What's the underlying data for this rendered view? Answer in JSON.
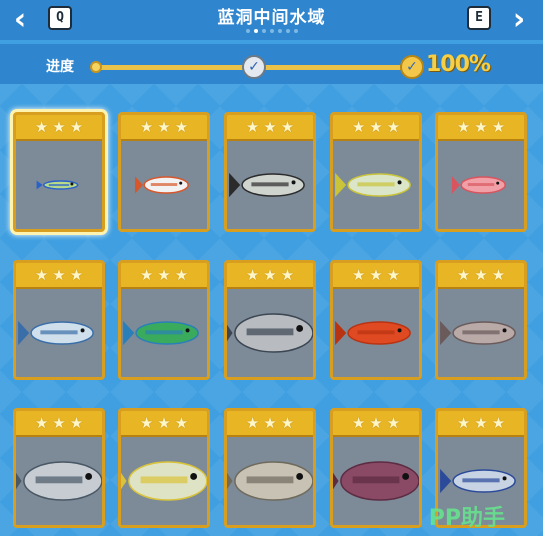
{
  "header": {
    "title": "蓝洞中间水域",
    "prev_key": "Q",
    "next_key": "E",
    "page_dots": 7,
    "active_dot": 1
  },
  "progress": {
    "label": "进度",
    "percent_text": "100%",
    "value": 1.0
  },
  "cards": [
    {
      "name": "tiny-green-fish",
      "stars": 3,
      "selected": true,
      "body": "#b8d98a",
      "accent": "#2a62c9",
      "size": "xs"
    },
    {
      "name": "clownfish",
      "stars": 3,
      "selected": false,
      "body": "#f2f2f2",
      "accent": "#d8572a",
      "size": "s"
    },
    {
      "name": "striped-fish",
      "stars": 3,
      "selected": false,
      "body": "#cfd4cf",
      "accent": "#2b2b2b",
      "size": "m"
    },
    {
      "name": "yellowtail-fish",
      "stars": 3,
      "selected": false,
      "body": "#dbe5c8",
      "accent": "#c9c43a",
      "size": "m"
    },
    {
      "name": "pink-fish",
      "stars": 3,
      "selected": false,
      "body": "#f0a0a6",
      "accent": "#d8555f",
      "size": "s"
    },
    {
      "name": "blue-mackerel",
      "stars": 3,
      "selected": false,
      "body": "#cfe0ec",
      "accent": "#3a6ea8",
      "size": "m"
    },
    {
      "name": "green-parrotfish",
      "stars": 3,
      "selected": false,
      "body": "#3aab5c",
      "accent": "#2a7fb8",
      "size": "m"
    },
    {
      "name": "tuna",
      "stars": 3,
      "selected": false,
      "body": "#b8bcc0",
      "accent": "#3b4652",
      "size": "l"
    },
    {
      "name": "red-grouper",
      "stars": 3,
      "selected": false,
      "body": "#e04a22",
      "accent": "#b83312",
      "size": "m"
    },
    {
      "name": "grey-fish",
      "stars": 3,
      "selected": false,
      "body": "#b9aaa8",
      "accent": "#6a5a5a",
      "size": "m"
    },
    {
      "name": "silver-tuna",
      "stars": 3,
      "selected": false,
      "body": "#c6ccd2",
      "accent": "#4a5866",
      "size": "l"
    },
    {
      "name": "yellowfin-fish",
      "stars": 3,
      "selected": false,
      "body": "#dfe3c6",
      "accent": "#d9c33a",
      "size": "l"
    },
    {
      "name": "squid",
      "stars": 3,
      "selected": false,
      "body": "#c7c2b4",
      "accent": "#6f6a5c",
      "size": "l"
    },
    {
      "name": "purple-grouper",
      "stars": 3,
      "selected": false,
      "body": "#8a4a66",
      "accent": "#5c2c42",
      "size": "l"
    },
    {
      "name": "blue-striped-fish",
      "stars": 3,
      "selected": false,
      "body": "#c8d4e4",
      "accent": "#2b4a9a",
      "size": "m"
    }
  ],
  "watermark": "PP助手",
  "icons": {
    "prev": "chevron-left-icon",
    "next": "chevron-right-icon",
    "checkpoint": "check-icon",
    "star": "star-icon"
  },
  "colors": {
    "background": "#3f9fe0",
    "card_frame": "#d89e20",
    "card_header": "#e8b524",
    "card_body": "#7d8a98",
    "progress_text": "#f6cf45"
  }
}
